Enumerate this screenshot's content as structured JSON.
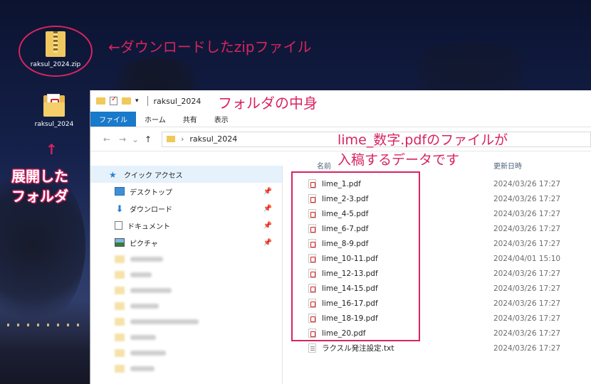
{
  "desktop": {
    "zip_icon": {
      "label": "raksul_2024.zip",
      "icon": "zip-folder-icon"
    },
    "folder_icon": {
      "label": "raksul_2024",
      "icon": "folder-with-pdf-icon"
    }
  },
  "annotations": {
    "zip_note": "←ダウンロードしたzipファイル",
    "folder_contents_note": "フォルダの中身",
    "up_arrow": "↑",
    "expanded_line1": "展開した",
    "expanded_line2": "フォルダ",
    "files_note_line1": "lime_数字.pdfのファイルが",
    "files_note_line2": "入稿するデータです",
    "accent_color": "#d8245f"
  },
  "window": {
    "title": "raksul_2024",
    "ribbon_tabs": [
      "ファイル",
      "ホーム",
      "共有",
      "表示"
    ],
    "nav": {
      "back": "←",
      "forward": "→",
      "recent": "⌄",
      "up": "↑"
    },
    "address": {
      "chevron": "›",
      "path": "raksul_2024"
    }
  },
  "sidebar": {
    "quick_access": {
      "label": "クイック アクセス",
      "icon": "star-icon"
    },
    "items": [
      {
        "label": "デスクトップ",
        "icon": "desktop-icon",
        "pin": "📌"
      },
      {
        "label": "ダウンロード",
        "icon": "download-icon",
        "pin": "📌"
      },
      {
        "label": "ドキュメント",
        "icon": "document-icon",
        "pin": "📌"
      },
      {
        "label": "ピクチャ",
        "icon": "pictures-icon",
        "pin": "📌"
      }
    ]
  },
  "columns": {
    "name": "名前",
    "date": "更新日時"
  },
  "files": [
    {
      "name": "lime_1.pdf",
      "date": "2024/03/26 17:27",
      "type": "pdf"
    },
    {
      "name": "lime_2-3.pdf",
      "date": "2024/03/26 17:27",
      "type": "pdf"
    },
    {
      "name": "lime_4-5.pdf",
      "date": "2024/03/26 17:27",
      "type": "pdf"
    },
    {
      "name": "lime_6-7.pdf",
      "date": "2024/03/26 17:27",
      "type": "pdf"
    },
    {
      "name": "lime_8-9.pdf",
      "date": "2024/03/26 17:27",
      "type": "pdf"
    },
    {
      "name": "lime_10-11.pdf",
      "date": "2024/04/01 15:10",
      "type": "pdf"
    },
    {
      "name": "lime_12-13.pdf",
      "date": "2024/03/26 17:27",
      "type": "pdf"
    },
    {
      "name": "lime_14-15.pdf",
      "date": "2024/03/26 17:27",
      "type": "pdf"
    },
    {
      "name": "lime_16-17.pdf",
      "date": "2024/03/26 17:27",
      "type": "pdf"
    },
    {
      "name": "lime_18-19.pdf",
      "date": "2024/03/26 17:27",
      "type": "pdf"
    },
    {
      "name": "lime_20.pdf",
      "date": "2024/03/26 17:27",
      "type": "pdf"
    },
    {
      "name": "ラクスル発注設定.txt",
      "date": "2024/03/26 17:27",
      "type": "txt"
    }
  ]
}
